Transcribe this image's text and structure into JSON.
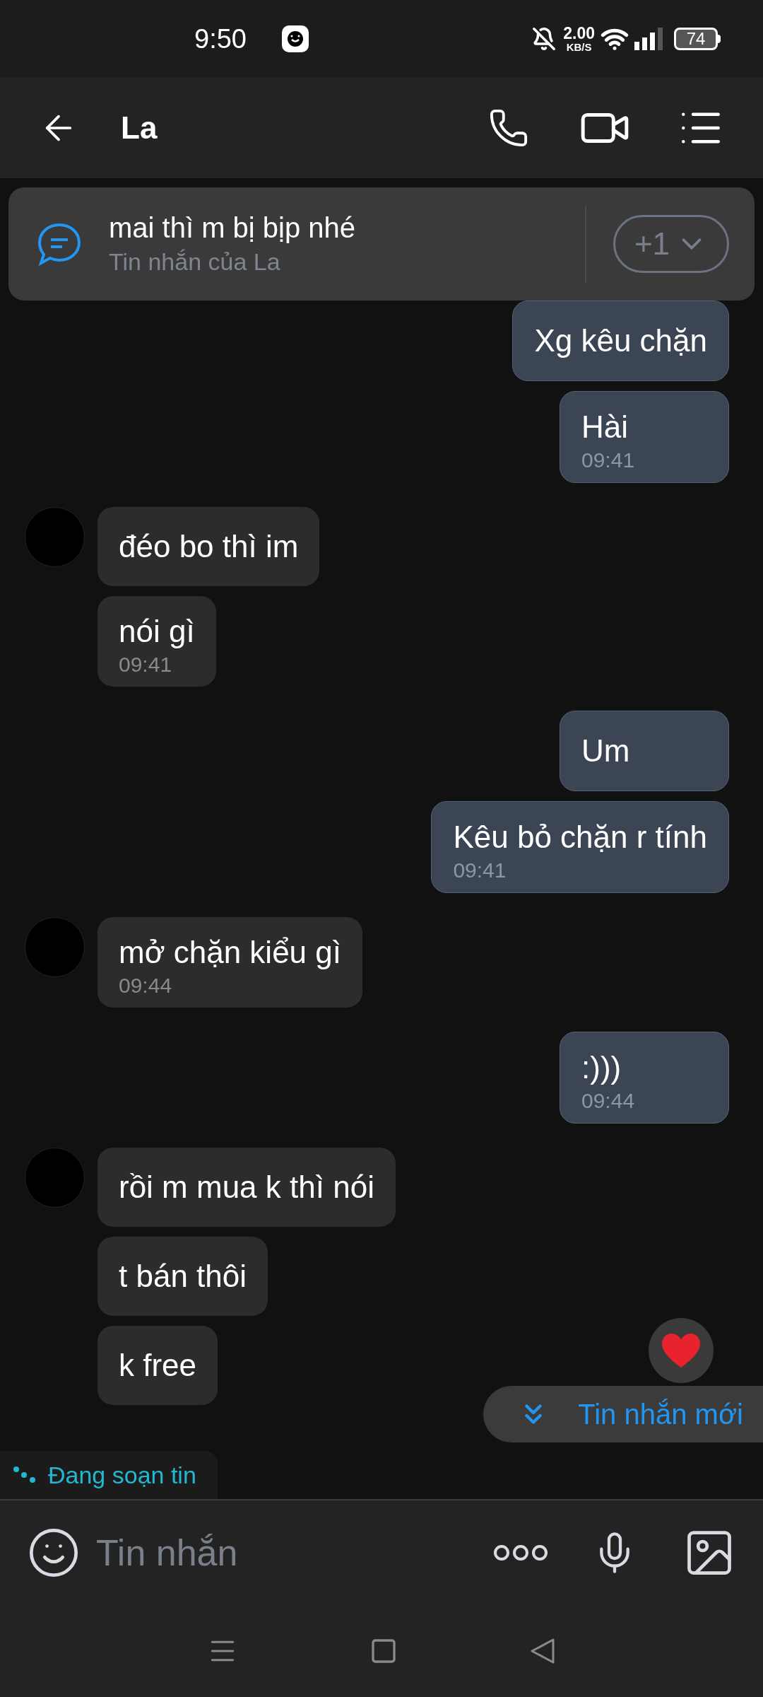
{
  "status_bar": {
    "time": "9:50",
    "speed_value": "2.00",
    "speed_unit": "KB/S",
    "battery": "74"
  },
  "header": {
    "title": "La"
  },
  "pinned": {
    "text": "mai thì m bị bịp nhé",
    "subtitle": "Tin nhắn của La",
    "count": "+1"
  },
  "messages": [
    {
      "kind": "outgoing",
      "text": "Xg kêu chặn"
    },
    {
      "kind": "outgoing",
      "text": "Hài",
      "time": "09:41"
    },
    {
      "kind": "incoming",
      "text": "đéo bo thì im",
      "show_avatar": true
    },
    {
      "kind": "incoming",
      "text": "nói gì",
      "time": "09:41",
      "show_avatar": false
    },
    {
      "kind": "outgoing",
      "text": "Um"
    },
    {
      "kind": "outgoing",
      "text": "Kêu bỏ chặn r tính",
      "time": "09:41"
    },
    {
      "kind": "incoming",
      "text": "mở chặn kiểu gì",
      "time": "09:44",
      "show_avatar": true
    },
    {
      "kind": "outgoing",
      "text": ":)))",
      "time": "09:44"
    },
    {
      "kind": "incoming",
      "text": "rồi m mua k thì nói",
      "show_avatar": true
    },
    {
      "kind": "incoming",
      "text": "t bán thôi",
      "show_avatar": false
    },
    {
      "kind": "incoming",
      "text": "k free",
      "show_avatar": false
    }
  ],
  "typing_indicator": "Đang soạn tin",
  "new_messages_button": "Tin nhắn mới",
  "composer": {
    "placeholder": "Tin nhắn"
  }
}
